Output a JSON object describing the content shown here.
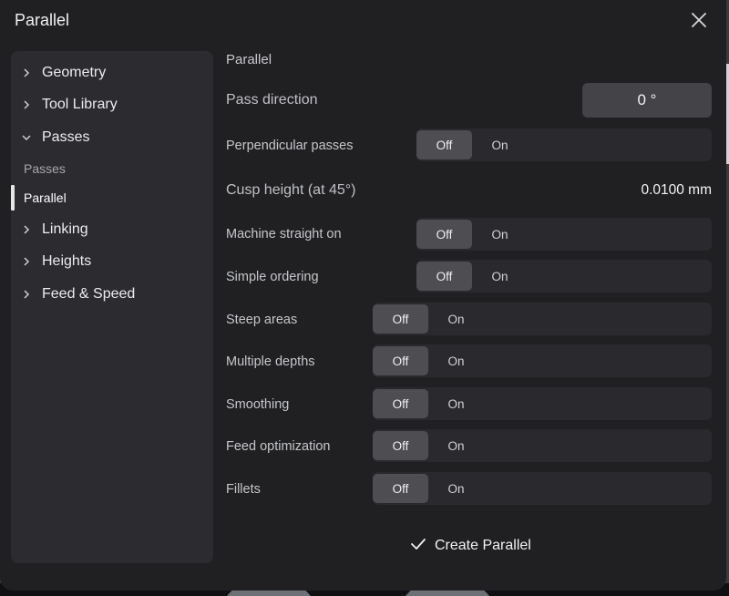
{
  "dialog": {
    "title": "Parallel"
  },
  "sidebar": {
    "items": [
      {
        "label": "Geometry"
      },
      {
        "label": "Tool Library"
      },
      {
        "label": "Passes"
      },
      {
        "label": "Linking"
      },
      {
        "label": "Heights"
      },
      {
        "label": "Feed & Speed"
      }
    ],
    "sub_heading": "Passes",
    "sub_items": [
      {
        "label": "Parallel"
      }
    ]
  },
  "content": {
    "section_title": "Parallel",
    "pass_direction": {
      "label": "Pass direction",
      "value": "0 °"
    },
    "cusp_height": {
      "label": "Cusp height (at 45°)",
      "value": "0.0100 mm"
    },
    "toggles": [
      {
        "label": "Perpendicular passes",
        "off": "Off",
        "on": "On",
        "state": "Off"
      },
      {
        "label": "Machine straight on",
        "off": "Off",
        "on": "On",
        "state": "Off"
      },
      {
        "label": "Simple ordering",
        "off": "Off",
        "on": "On",
        "state": "Off"
      },
      {
        "label": "Steep areas",
        "off": "Off",
        "on": "On",
        "state": "Off"
      },
      {
        "label": "Multiple depths",
        "off": "Off",
        "on": "On",
        "state": "Off"
      },
      {
        "label": "Smoothing",
        "off": "Off",
        "on": "On",
        "state": "Off"
      },
      {
        "label": "Feed optimization",
        "off": "Off",
        "on": "On",
        "state": "Off"
      },
      {
        "label": "Fillets",
        "off": "Off",
        "on": "On",
        "state": "Off"
      }
    ]
  },
  "footer": {
    "create_label": "Create Parallel"
  },
  "colors": {
    "dialog_bg": "#202023",
    "sidebar_bg": "#2c2c30",
    "toggle_selected": "#4d4d52"
  }
}
